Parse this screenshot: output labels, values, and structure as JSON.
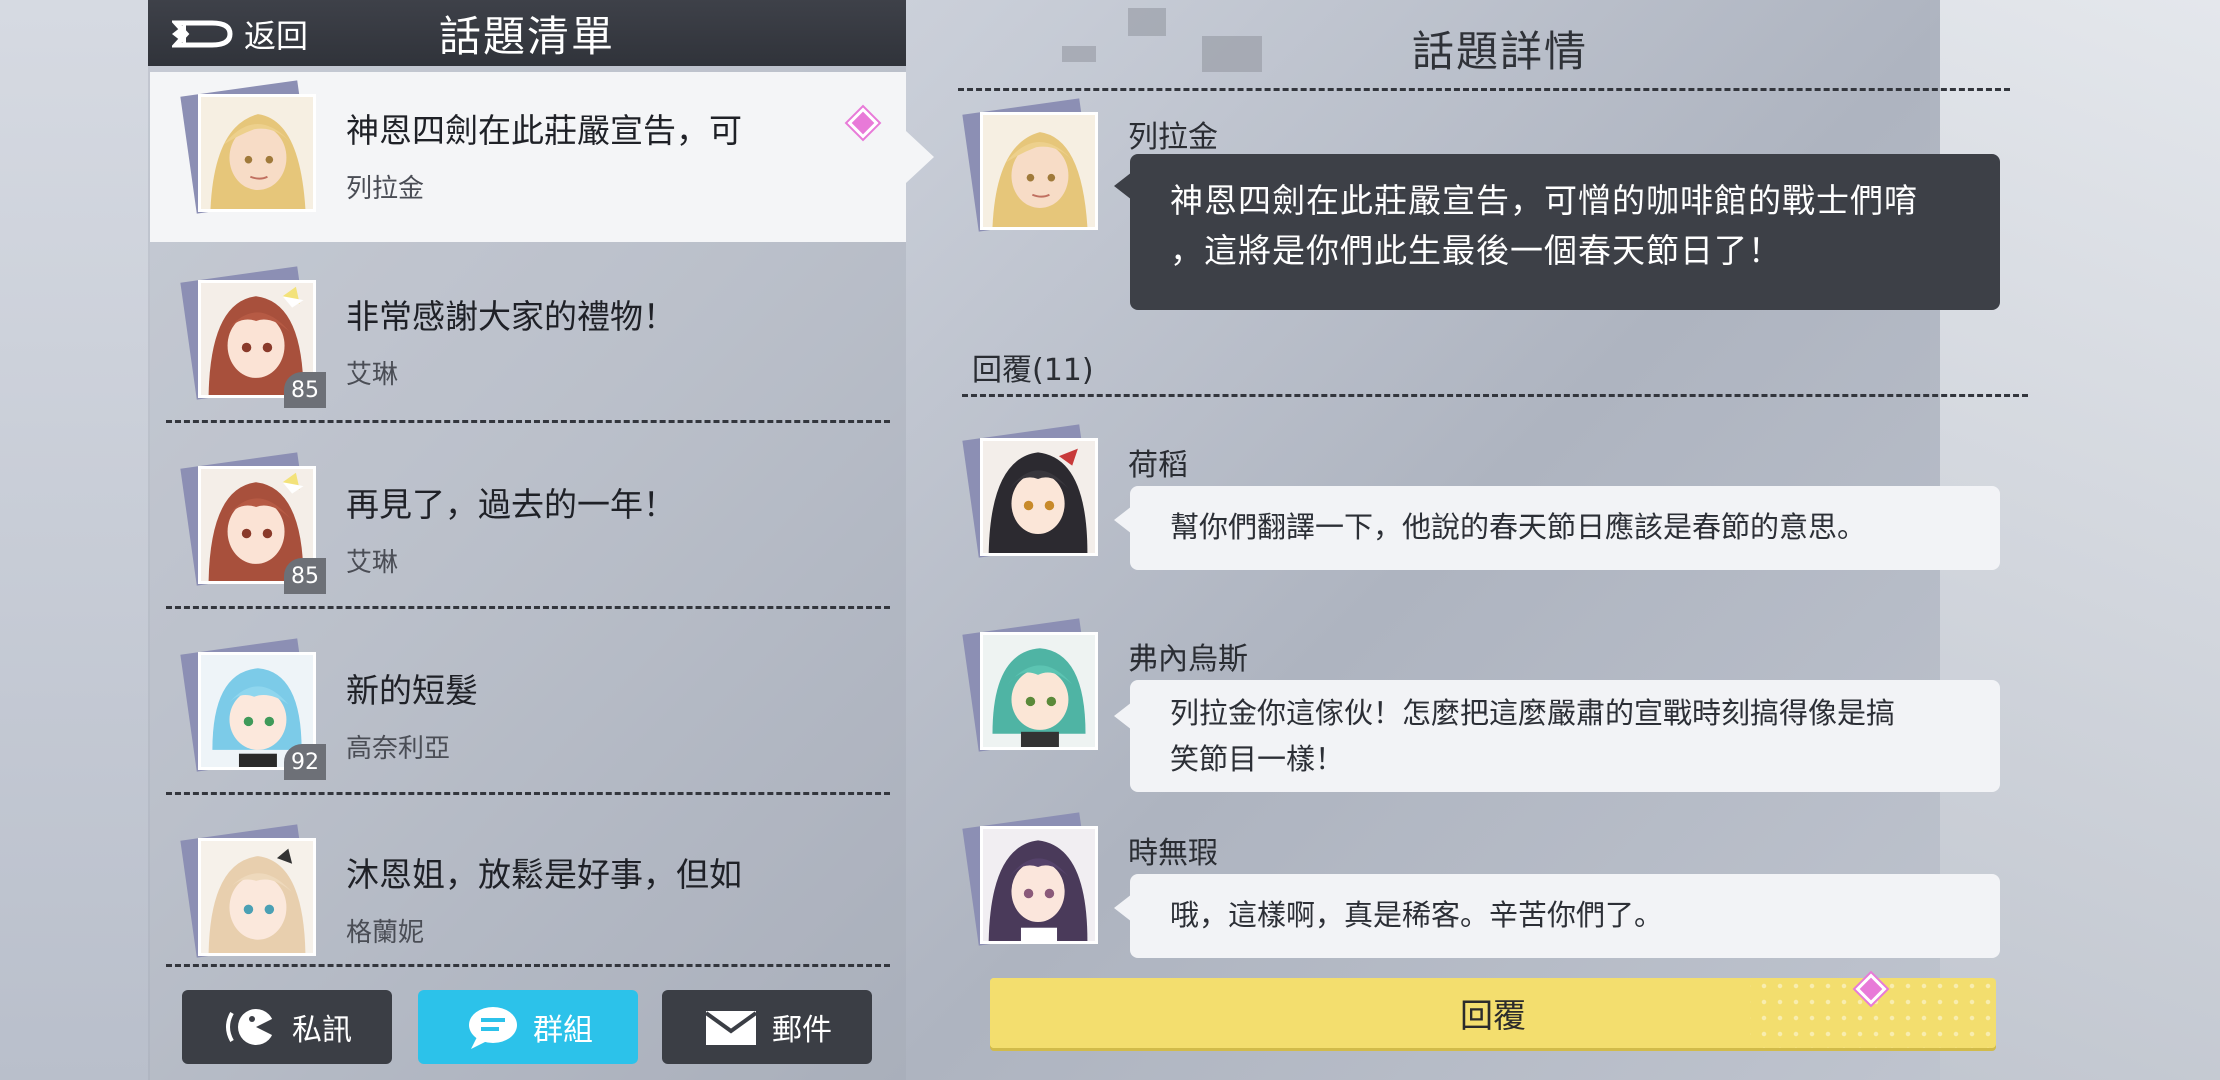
{
  "header": {
    "back_label": "返回",
    "list_title": "話題清單",
    "detail_title": "話題詳情"
  },
  "topics": [
    {
      "title": "神恩四劍在此莊嚴宣告，可",
      "author": "列拉金",
      "level": "",
      "selected": true,
      "icon": "blonde-man-avatar"
    },
    {
      "title": "非常感謝大家的禮物！",
      "author": "艾琳",
      "level": "85",
      "icon": "red-hair-girl-avatar"
    },
    {
      "title": "再見了，過去的一年！",
      "author": "艾琳",
      "level": "85",
      "icon": "red-hair-girl-avatar"
    },
    {
      "title": "新的短髮",
      "author": "高奈利亞",
      "level": "92",
      "icon": "blue-hair-girl-avatar"
    },
    {
      "title": "沐恩姐，放鬆是好事，但如",
      "author": "格蘭妮",
      "level": "",
      "icon": "blonde-girl-avatar"
    }
  ],
  "tabs": [
    {
      "label": "私訊",
      "icon": "chat-face-icon",
      "active": false
    },
    {
      "label": "群組",
      "icon": "group-chat-icon",
      "active": true
    },
    {
      "label": "郵件",
      "icon": "mail-icon",
      "active": false
    }
  ],
  "post": {
    "author": "列拉金",
    "lines": [
      "神恩四劍在此莊嚴宣告，可憎的咖啡館的戰士們唷",
      "，這將是你們此生最後一個春天節日了！"
    ]
  },
  "replies_label": "回覆(11)",
  "replies": [
    {
      "author": "荷稻",
      "lines": [
        "幫你們翻譯一下，他說的春天節日應該是春節的意思。"
      ]
    },
    {
      "author": "弗內烏斯",
      "lines": [
        "列拉金你這傢伙！怎麼把這麼嚴肅的宣戰時刻搞得像是搞",
        "笑節目一樣！"
      ]
    },
    {
      "author": "時無瑕",
      "lines": [
        "哦，這樣啊，真是稀客。辛苦你們了。"
      ]
    }
  ],
  "reply_button_label": "回覆",
  "colors": {
    "accent_tab": "#2cc2ea",
    "reply_button": "#f3de6e",
    "new_marker": "#e87ad8",
    "dark_bubble": "#3d4047"
  }
}
